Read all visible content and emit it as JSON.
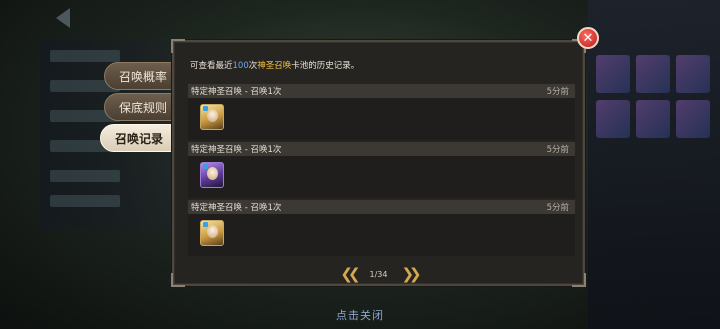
{
  "tabs": [
    {
      "label": "召唤概率",
      "active": false
    },
    {
      "label": "保底规则",
      "active": false
    },
    {
      "label": "召唤记录",
      "active": true
    }
  ],
  "intro": {
    "prefix": "可查看最近",
    "count": "100",
    "mid": "次",
    "pool": "神圣召唤",
    "suffix": "卡池的历史记录。"
  },
  "records": [
    {
      "title": "特定神圣召唤 - 召唤1次",
      "time": "5分前",
      "rarity": "gold",
      "icon": "hero-portrait-icon"
    },
    {
      "title": "特定神圣召唤 - 召唤1次",
      "time": "5分前",
      "rarity": "purple",
      "icon": "hero-portrait-icon"
    },
    {
      "title": "特定神圣召唤 - 召唤1次",
      "time": "5分前",
      "rarity": "gold",
      "icon": "hero-portrait-icon"
    }
  ],
  "pager": {
    "label": "1/34",
    "prev_icon": "double-chevron-left-icon",
    "next_icon": "double-chevron-right-icon"
  },
  "close_button": {
    "symbol": "✕",
    "icon": "close-icon"
  },
  "footer": {
    "tap_to_close": "点击关闭"
  },
  "colors": {
    "accent_blue": "#6aa8ff",
    "accent_gold": "#f0c040",
    "close_red": "#d9342c",
    "arrow_gold": "#d8a850"
  }
}
